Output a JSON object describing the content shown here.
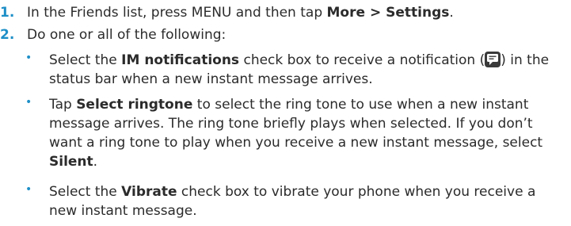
{
  "steps": [
    {
      "number": "1.",
      "prefix": "In the Friends list, press MENU and then tap ",
      "bold": "More > Settings",
      "suffix": "."
    },
    {
      "number": "2.",
      "text": "Do one or all of the following:"
    }
  ],
  "bullets": [
    {
      "bullet": "•",
      "line1_pre": "Select the ",
      "line1_bold": "IM notifications",
      "line1_post": " check box to receive a notification (",
      "line1_post2": ") in the",
      "line2": "status bar when a new instant message arrives.",
      "icon": "im-notification-icon"
    },
    {
      "bullet": "•",
      "line1_pre": "Tap ",
      "line1_bold": "Select ringtone",
      "line1_post": " to select the ring tone to use when a new instant",
      "line2": "message arrives. The ring tone briefly plays when selected. If you don’t",
      "line3": "want a ring tone to play when you receive a new instant message, select",
      "line4_bold": "Silent",
      "line4_post": "."
    },
    {
      "bullet": "•",
      "line1_pre": "Select the ",
      "line1_bold": "Vibrate",
      "line1_post": " check box to vibrate your phone when you receive a",
      "line2": "new instant message."
    }
  ]
}
